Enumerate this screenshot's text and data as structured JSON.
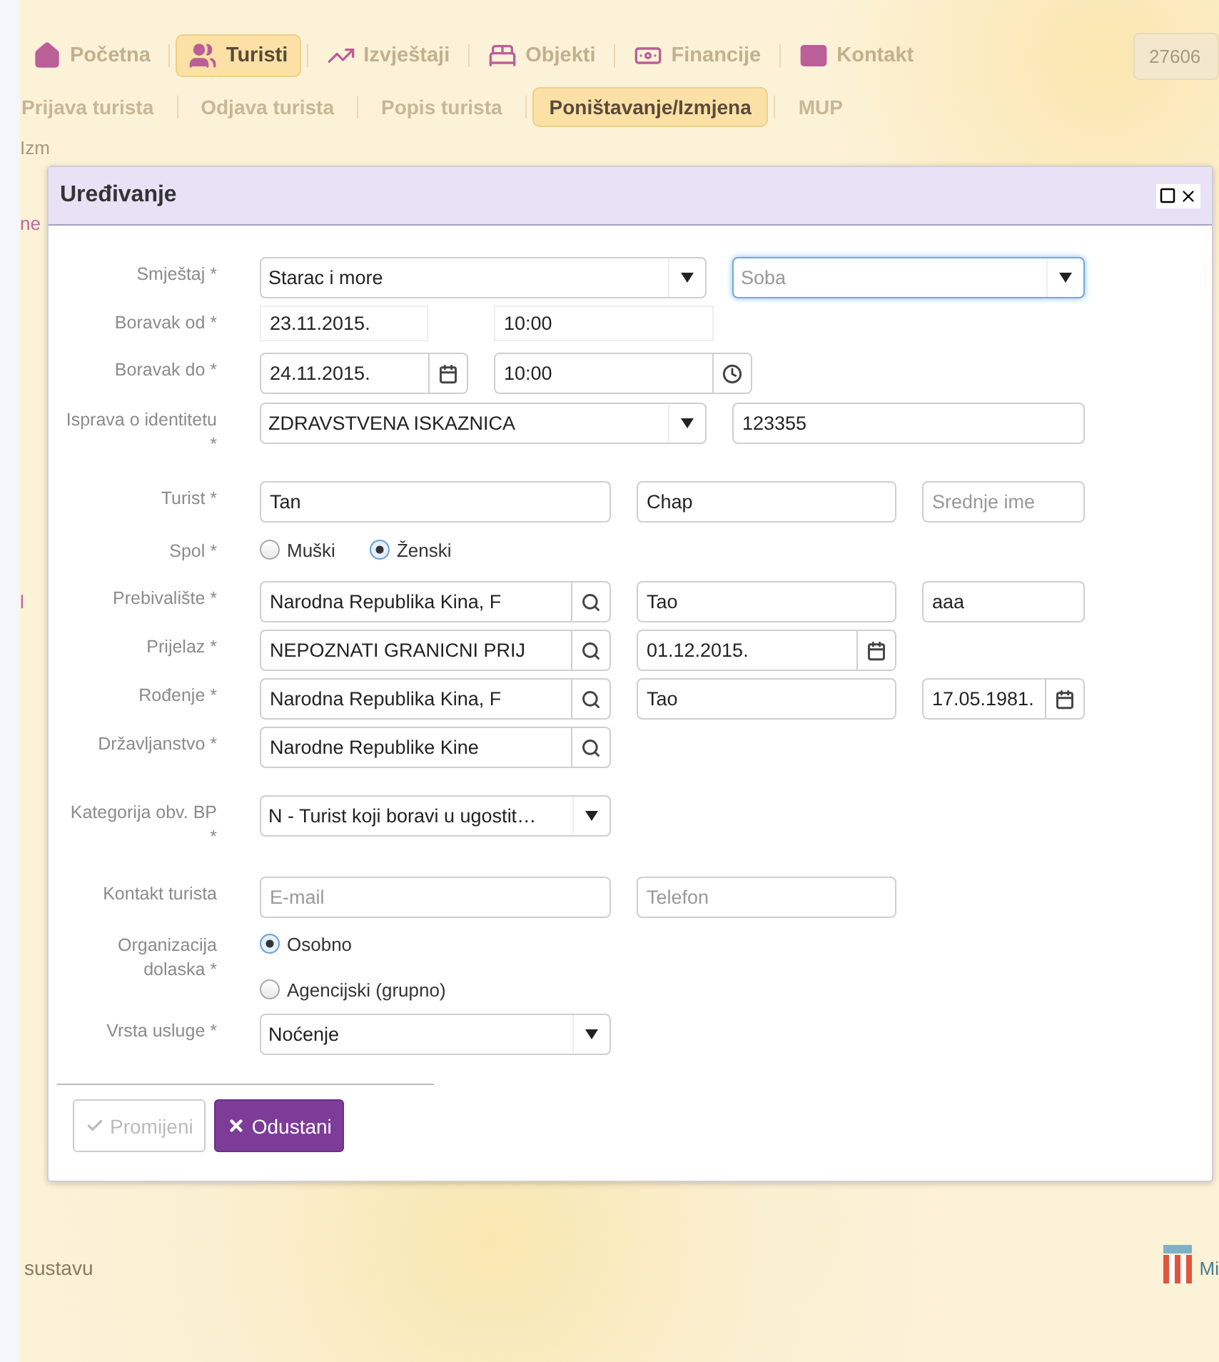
{
  "nav": {
    "items": [
      {
        "label": "Početna",
        "selected": false
      },
      {
        "label": "Turisti",
        "selected": true
      },
      {
        "label": "Izvještaji",
        "selected": false
      },
      {
        "label": "Objekti",
        "selected": false
      },
      {
        "label": "Financije",
        "selected": false
      },
      {
        "label": "Kontakt",
        "selected": false
      }
    ],
    "user_field": "27606"
  },
  "subnav": [
    {
      "label": "Prijava turista",
      "selected": false
    },
    {
      "label": "Odjava turista",
      "selected": false
    },
    {
      "label": "Popis turista",
      "selected": false
    },
    {
      "label": "Poništavanje/Izmjena",
      "selected": true
    },
    {
      "label": "MUP",
      "selected": false
    }
  ],
  "background_fragments": [
    "Izm",
    "ne",
    "l"
  ],
  "dialog": {
    "title": "Uređivanje",
    "rows": [
      {
        "label": "Smještaj *",
        "controls": [
          {
            "kind": "select",
            "value": "Starac i more",
            "focused": false
          },
          {
            "kind": "select",
            "placeholder": "Soba",
            "focused": true
          }
        ]
      },
      {
        "label": "Boravak od *",
        "controls": [
          {
            "kind": "input",
            "value": "23.11.2015."
          },
          {
            "kind": "input",
            "value": "10:00"
          }
        ]
      },
      {
        "label": "Boravak do *",
        "controls": [
          {
            "kind": "date",
            "value": "24.11.2015."
          },
          {
            "kind": "time",
            "value": "10:00"
          }
        ]
      },
      {
        "label": "Isprava o identitetu *",
        "controls": [
          {
            "kind": "select",
            "value": "ZDRAVSTVENA ISKAZNICA",
            "focused": false
          },
          {
            "kind": "input",
            "value": "123355"
          }
        ]
      },
      {
        "label": "Turist *",
        "controls": [
          {
            "kind": "input",
            "value": "Tan"
          },
          {
            "kind": "input",
            "value": "Chap"
          },
          {
            "kind": "input",
            "placeholder": "Srednje ime"
          }
        ]
      },
      {
        "label": "Spol *",
        "controls": [
          {
            "kind": "radio",
            "label": "Muški",
            "selected": false
          },
          {
            "kind": "radio",
            "label": "Ženski",
            "selected": true
          }
        ]
      },
      {
        "label": "Prebivalište *",
        "controls": [
          {
            "kind": "search",
            "value": "Narodna Republika Kina, F"
          },
          {
            "kind": "input",
            "value": "Tao"
          },
          {
            "kind": "input",
            "value": "aaa"
          }
        ]
      },
      {
        "label": "Prijelaz *",
        "controls": [
          {
            "kind": "search",
            "value": "NEPOZNATI GRANICNI PRIJ"
          },
          {
            "kind": "date",
            "value": "01.12.2015."
          }
        ]
      },
      {
        "label": "Rođenje *",
        "controls": [
          {
            "kind": "search",
            "value": "Narodna Republika Kina, F"
          },
          {
            "kind": "input",
            "value": "Tao"
          },
          {
            "kind": "date",
            "value": "17.05.1981."
          }
        ]
      },
      {
        "label": "Državljanstvo *",
        "controls": [
          {
            "kind": "search",
            "value": "Narodne Republike Kine"
          }
        ]
      },
      {
        "label": "Kategorija obv. BP *",
        "controls": [
          {
            "kind": "select",
            "value": "N - Turist koji boravi u ugostit…",
            "focused": false
          }
        ]
      },
      {
        "label": "Kontakt turista",
        "controls": [
          {
            "kind": "input",
            "placeholder": "E-mail"
          },
          {
            "kind": "input",
            "placeholder": "Telefon"
          }
        ]
      },
      {
        "label": "Organizacija dolaska *",
        "controls": [
          {
            "kind": "radio",
            "label": "Osobno",
            "selected": true
          },
          {
            "kind": "radio",
            "label": "Agencijski (grupno)",
            "selected": false
          }
        ]
      },
      {
        "label": "Vrsta usluge *",
        "controls": [
          {
            "kind": "select",
            "value": "Noćenje",
            "focused": false
          }
        ]
      }
    ],
    "buttons": [
      {
        "label": "Promijeni",
        "kind": "default",
        "disabled": true
      },
      {
        "label": "Odustani",
        "kind": "primary",
        "disabled": false
      }
    ]
  },
  "footer": {
    "text": "sustavu",
    "logo_text": "Mi"
  }
}
